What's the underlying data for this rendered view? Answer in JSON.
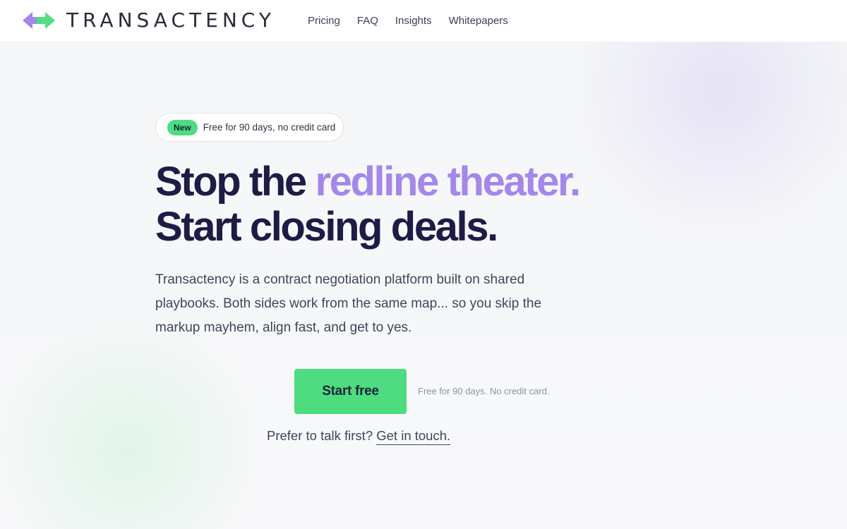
{
  "header": {
    "brand": "TRANSACTENCY",
    "nav": [
      "Pricing",
      "FAQ",
      "Insights",
      "Whitepapers"
    ]
  },
  "hero": {
    "badge_label": "New",
    "badge_text": "Free for 90 days, no credit card",
    "headline_part1": "Stop the ",
    "headline_accent": "redline theater.",
    "headline_line2": "Start closing deals.",
    "body": "Transactency is a contract negotiation platform built on shared playbooks. Both sides work from the same map... so you skip the markup mayhem, align fast, and get to yes.",
    "cta_label": "Start free",
    "cta_note": "Free for 90 days. No credit card.",
    "talk_prefix": "Prefer to talk first? ",
    "talk_link": "Get in touch."
  },
  "colors": {
    "accent_purple": "#a487ec",
    "accent_green": "#4ddc7f",
    "headline": "#1e1b47"
  }
}
